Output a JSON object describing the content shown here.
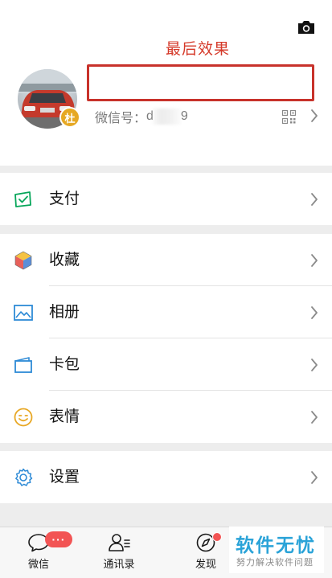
{
  "annotation": "最后效果",
  "profile": {
    "avatar_badge": "杜",
    "wechat_id_label": "微信号：",
    "wechat_id_prefix": "d",
    "wechat_id_suffix": "9"
  },
  "menu": {
    "payment": "支付",
    "favorites": "收藏",
    "album": "相册",
    "cards": "卡包",
    "stickers": "表情",
    "settings": "设置"
  },
  "tabbar": {
    "chats": "微信",
    "contacts": "通讯录",
    "discover": "发现",
    "chats_badge": "···"
  },
  "watermark": {
    "title": "软件无忧",
    "subtitle": "努力解决软件问题"
  },
  "colors": {
    "accent_green": "#07c160",
    "badge_red": "#f25454",
    "annotation_red": "#c8322b",
    "watermark_blue": "#2aa3d8"
  }
}
